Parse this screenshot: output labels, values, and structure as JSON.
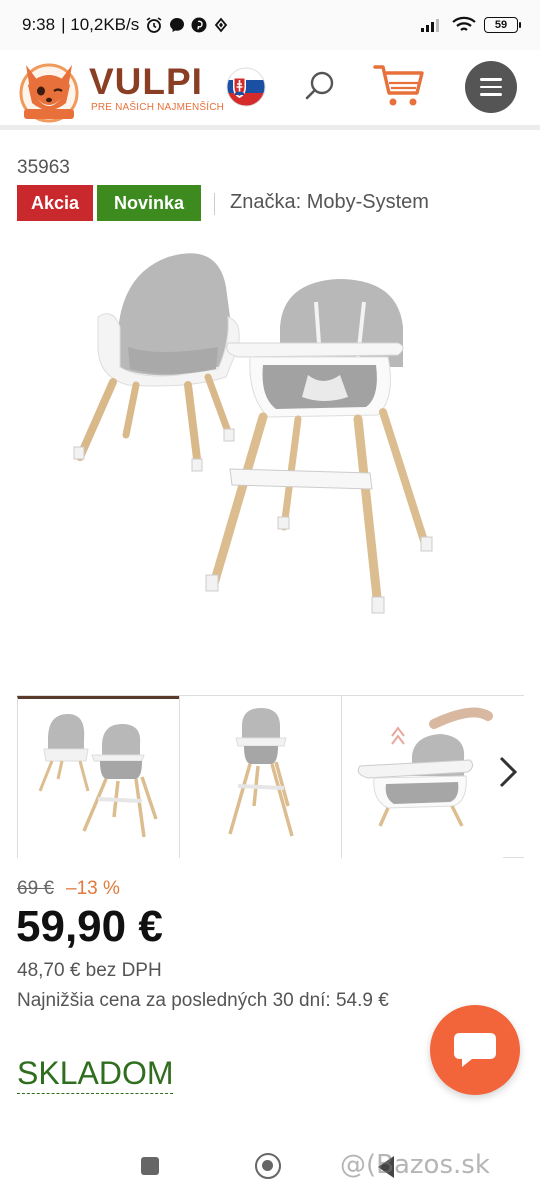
{
  "status_bar": {
    "time": "9:38",
    "net_speed": "| 10,2KB/s",
    "battery": "59"
  },
  "header": {
    "brand": "VULPI",
    "tagline": "PRE NAŠICH NAJMENŠÍCH",
    "flag": "slovak-flag",
    "icons": [
      "search-icon",
      "cart-icon",
      "menu-icon"
    ],
    "accent_color": "#e8703a",
    "brand_color": "#8a3e24"
  },
  "product": {
    "sku": "35963",
    "badges": [
      {
        "label": "Akcia",
        "color": "#c9282d"
      },
      {
        "label": "Novinka",
        "color": "#3d8a1e"
      }
    ],
    "brand_line": "Značka: Moby-System",
    "image_alt": "high-chair-product-image"
  },
  "gallery": {
    "active_index": 0,
    "thumbs": [
      "thumb-1",
      "thumb-2",
      "thumb-3"
    ]
  },
  "pricing": {
    "old_price": "69 €",
    "discount": "–13 %",
    "price": "59,90 €",
    "price_net": "48,70 € bez DPH",
    "lowest_30": "Najnižšia cena za posledných 30 dní: 54.9 €"
  },
  "stock": {
    "label": "SKLADOM",
    "color": "#2f6e1e"
  },
  "chat": {
    "color": "#f2643a"
  },
  "watermark": "@(Bazos.sk"
}
